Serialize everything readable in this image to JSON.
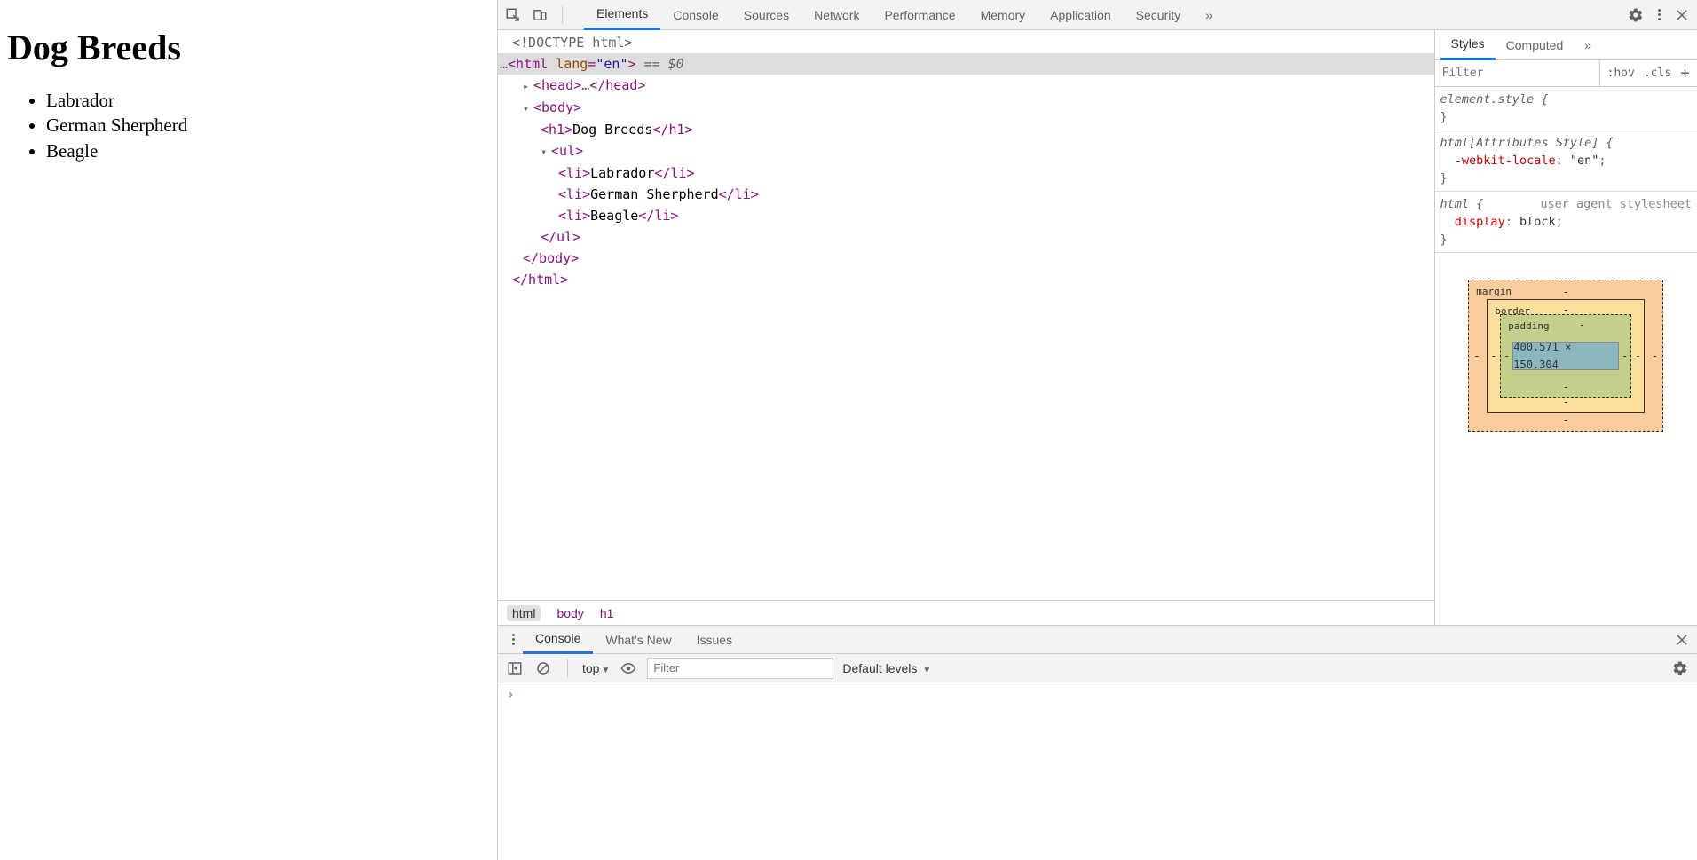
{
  "page": {
    "title": "Dog Breeds",
    "items": [
      "Labrador",
      "German Sherpherd",
      "Beagle"
    ]
  },
  "devtools": {
    "toolbar": {
      "tabs": [
        "Elements",
        "Console",
        "Sources",
        "Network",
        "Performance",
        "Memory",
        "Application",
        "Security"
      ],
      "more": "»",
      "activeTab": "Elements"
    },
    "tree": {
      "doctype": "<!DOCTYPE html>",
      "htmlOpenPrefix": "…",
      "htmlOpen": "<html lang=\"en\">",
      "htmlOpenSuffix": " == $0",
      "headCollapsed": "<head>…</head>",
      "bodyOpen": "<body>",
      "h1": "<h1>Dog Breeds</h1>",
      "ulOpen": "<ul>",
      "li": [
        "<li>Labrador</li>",
        "<li>German Sherpherd</li>",
        "<li>Beagle</li>"
      ],
      "ulClose": "</ul>",
      "bodyClose": "</body>",
      "htmlClose": "</html>"
    },
    "breadcrumbs": [
      "html",
      "body",
      "h1"
    ],
    "styles": {
      "tabs": [
        "Styles",
        "Computed"
      ],
      "more": "»",
      "filterPlaceholder": "Filter",
      "hov": ":hov",
      "cls": ".cls",
      "rules": [
        {
          "selector": "element.style {",
          "close": "}"
        },
        {
          "selector": "html[Attributes Style] {",
          "prop": "-webkit-locale",
          "val": "\"en\"",
          "close": "}"
        },
        {
          "selector": "html {",
          "src": "user agent stylesheet",
          "prop": "display",
          "val": "block",
          "close": "}"
        }
      ],
      "box": {
        "marginLabel": "margin",
        "borderLabel": "border",
        "paddingLabel": "padding",
        "content": "400.571 × 150.304",
        "dash": "-"
      }
    },
    "drawer": {
      "tabs": [
        "Console",
        "What's New",
        "Issues"
      ],
      "console": {
        "context": "top",
        "filterPlaceholder": "Filter",
        "levels": "Default levels",
        "prompt": "›"
      }
    }
  }
}
